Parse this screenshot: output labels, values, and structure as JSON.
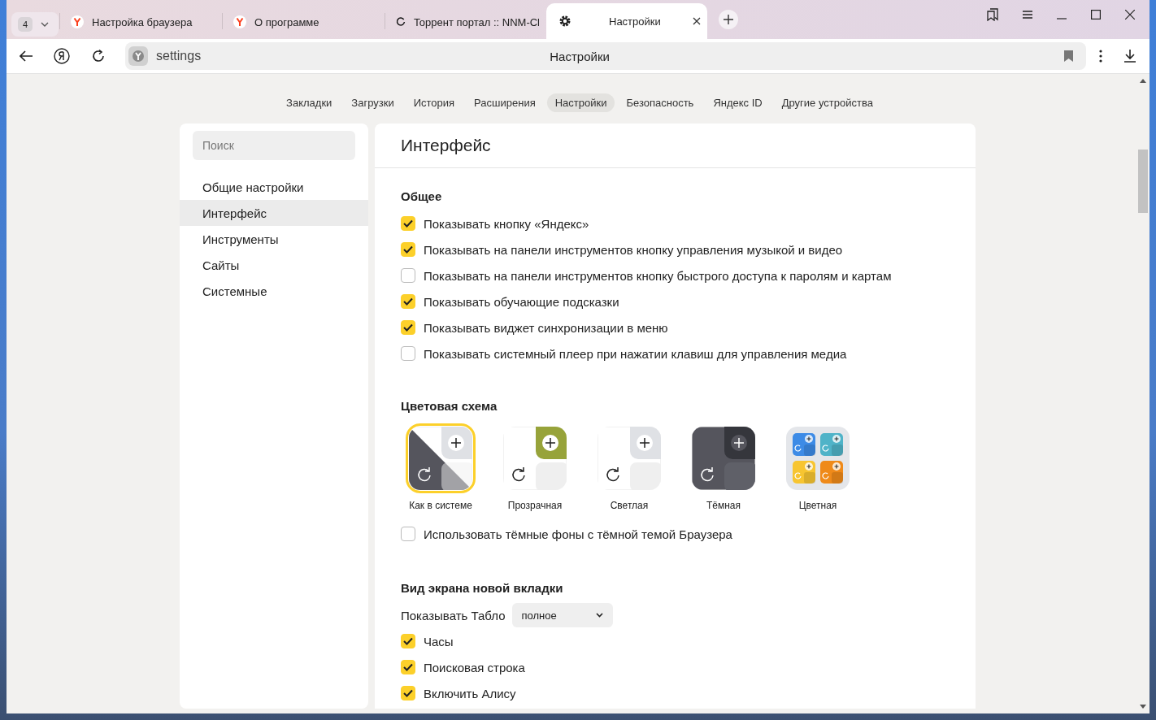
{
  "tab_strip": {
    "tab_count": "4",
    "tabs": [
      {
        "title": "Настройка браузера",
        "kind": "yandex",
        "selected": false
      },
      {
        "title": "О программе",
        "kind": "yandex",
        "selected": false
      },
      {
        "title": "Торрент портал :: NNM-Cl",
        "kind": "loading",
        "selected": false
      },
      {
        "title": "Настройки",
        "kind": "gear",
        "selected": true
      }
    ]
  },
  "toolbar": {
    "address": "settings",
    "page_title": "Настройки"
  },
  "nav": [
    {
      "label": "Закладки",
      "selected": false
    },
    {
      "label": "Загрузки",
      "selected": false
    },
    {
      "label": "История",
      "selected": false
    },
    {
      "label": "Расширения",
      "selected": false
    },
    {
      "label": "Настройки",
      "selected": true
    },
    {
      "label": "Безопасность",
      "selected": false
    },
    {
      "label": "Яндекс ID",
      "selected": false
    },
    {
      "label": "Другие устройства",
      "selected": false
    }
  ],
  "sidebar": {
    "search": {
      "placeholder": "Поиск"
    },
    "items": [
      {
        "label": "Общие настройки",
        "selected": false
      },
      {
        "label": "Интерфейс",
        "selected": true
      },
      {
        "label": "Инструменты",
        "selected": false
      },
      {
        "label": "Сайты",
        "selected": false
      },
      {
        "label": "Системные",
        "selected": false
      }
    ]
  },
  "main": {
    "title": "Интерфейс",
    "general": {
      "heading": "Общее",
      "options": [
        {
          "label": "Показывать кнопку «Яндекс»",
          "checked": true
        },
        {
          "label": "Показывать на панели инструментов кнопку управления музыкой и видео",
          "checked": true
        },
        {
          "label": "Показывать на панели инструментов кнопку быстрого доступа к паролям и картам",
          "checked": false
        },
        {
          "label": "Показывать обучающие подсказки",
          "checked": true
        },
        {
          "label": "Показывать виджет синхронизации в меню",
          "checked": true
        },
        {
          "label": "Показывать системный плеер при нажатии клавиш для управления медиа",
          "checked": false
        }
      ]
    },
    "color_scheme": {
      "heading": "Цветовая схема",
      "themes": [
        {
          "label": "Как в системе",
          "kind": "system",
          "selected": true
        },
        {
          "label": "Прозрачная",
          "kind": "transparent",
          "selected": false
        },
        {
          "label": "Светлая",
          "kind": "light",
          "selected": false
        },
        {
          "label": "Тёмная",
          "kind": "dark",
          "selected": false
        },
        {
          "label": "Цветная",
          "kind": "colored",
          "selected": false
        }
      ],
      "options": [
        {
          "label": "Использовать тёмные фоны с тёмной темой Браузера",
          "checked": false
        }
      ]
    },
    "new_tab": {
      "heading": "Вид экрана новой вкладки",
      "tablo_label": "Показывать Табло",
      "tablo_value": "полное",
      "options": [
        {
          "label": "Часы",
          "checked": true
        },
        {
          "label": "Поисковая строка",
          "checked": true
        },
        {
          "label": "Включить Алису",
          "checked": true
        }
      ]
    }
  }
}
